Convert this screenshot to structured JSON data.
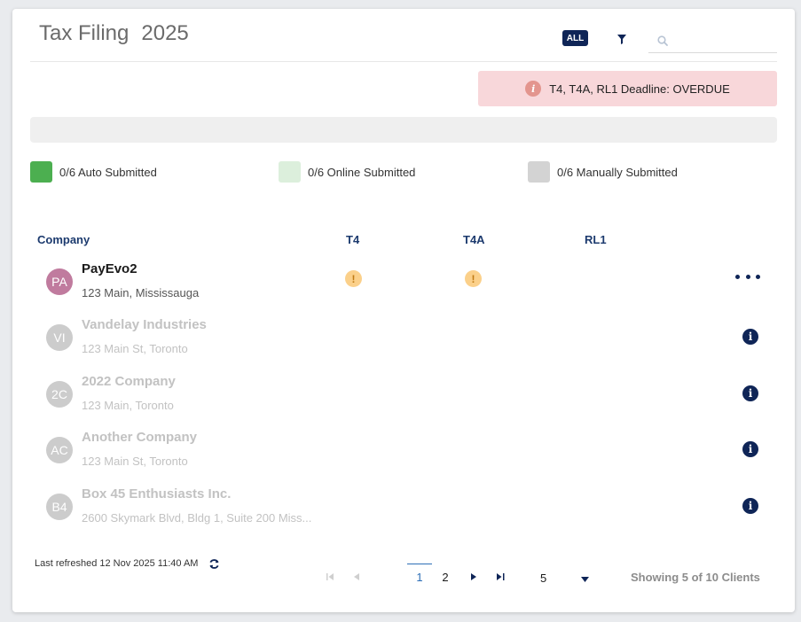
{
  "header": {
    "title": "Tax Filing",
    "year": "2025",
    "all_label": "ALL",
    "search_placeholder": ""
  },
  "deadline_alert": {
    "text": "T4, T4A, RL1 Deadline: OVERDUE",
    "icon_glyph": "i"
  },
  "legend": [
    {
      "label": "0/6 Auto Submitted",
      "color": "#4caf50"
    },
    {
      "label": "0/6 Online Submitted",
      "color": "#dcefdc"
    },
    {
      "label": "0/6 Manually Submitted",
      "color": "#d3d3d3"
    }
  ],
  "table": {
    "columns": [
      "Company",
      "T4",
      "T4A",
      "RL1"
    ],
    "rows": [
      {
        "initials": "PA",
        "name": "PayEvo2",
        "address": "123 Main, Mississauga",
        "avatar_color": "#c07b9e",
        "active": true,
        "t4": "!",
        "t4a": "!"
      },
      {
        "initials": "VI",
        "name": "Vandelay Industries",
        "address": "123 Main St, Toronto",
        "avatar_color": "#cccccc",
        "active": false
      },
      {
        "initials": "2C",
        "name": "2022 Company",
        "address": "123 Main, Toronto",
        "avatar_color": "#cccccc",
        "active": false
      },
      {
        "initials": "AC",
        "name": "Another Company",
        "address": "123 Main St, Toronto",
        "avatar_color": "#cccccc",
        "active": false
      },
      {
        "initials": "B4",
        "name": "Box 45 Enthusiasts Inc.",
        "address": "2600 Skymark Blvd, Bldg 1, Suite 200 Miss...",
        "avatar_color": "#cccccc",
        "active": false
      }
    ]
  },
  "footer": {
    "last_refreshed": "Last refreshed 12 Nov 2025 11:40 AM",
    "pages": [
      "1",
      "2"
    ],
    "current_page": "1",
    "page_size": "5",
    "showing": "Showing 5 of 10 Clients"
  },
  "colors": {
    "primary": "#0f2557",
    "alert_bg": "#f8d7da",
    "warning": "#fbd08a"
  }
}
